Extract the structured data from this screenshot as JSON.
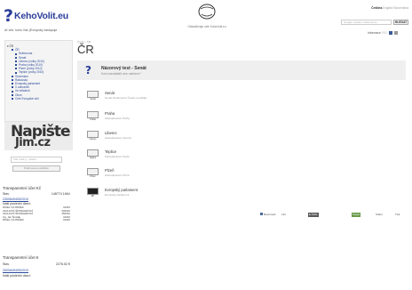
{
  "header": {
    "logo_mark": "?",
    "logo_text": "KehoVolit.eu",
    "tagline": "Ať víte, koho Vás (Evropský zastupuje",
    "center_link": "Oblasti/kraje celé KohoVolit.eu",
    "lang": {
      "prefix": "Čeština",
      "sep1": "English",
      "sep2": "Slovenčina"
    },
    "search_placeholder": "Google: hledat v dokumentu",
    "search_button": "HLEDAT",
    "info_label": "Informace",
    "info_link": "RSS"
  },
  "sidebar": {
    "tree": [
      {
        "level": 0,
        "label": "ČR"
      },
      {
        "level": 1,
        "label": "ČR"
      },
      {
        "level": 2,
        "label": "Sněmovna"
      },
      {
        "level": 2,
        "label": "Senát"
      },
      {
        "level": 2,
        "label": "Liberec (volby 2010)"
      },
      {
        "level": 2,
        "label": "Praha (volby 2010)"
      },
      {
        "level": 2,
        "label": "Plzeň (volby 2010)"
      },
      {
        "level": 2,
        "label": "Teplice (volby 2010)"
      },
      {
        "level": 1,
        "label": "Slovensko"
      },
      {
        "level": 1,
        "label": "Rakousko"
      },
      {
        "level": 1,
        "label": "Evropský parlament"
      },
      {
        "level": 1,
        "label": "V zahraničí"
      },
      {
        "level": 1,
        "label": "Ve městech"
      },
      {
        "level": 1,
        "label": "Obce"
      },
      {
        "level": 1,
        "label": "Celé Evropské uhlí"
      }
    ],
    "napiste_line1": "Napište",
    "napiste_line2": "Jim.cz",
    "email_placeholder": "Váš mail(+), ostatní...",
    "send_button": "Pošli pouze politikům",
    "accounts": [
      {
        "title": "Transparentní účet Kč",
        "state_label": "Stav",
        "state_value": "148774 16Kč",
        "account_no": "2300849405/2010",
        "recent_label": "Naši poslední dárci:",
        "transactions": [
          {
            "name": "PAVEL VOJTÉŠEK",
            "amount": "100Kč"
          },
          {
            "name": "VACHOVÁ ŠPINDLEROVÁ",
            "amount": "5000Kč"
          },
          {
            "name": "VACHOVÁ ŠPINDLEROVÁ",
            "amount": "3500Kč"
          },
          {
            "name": "Ing. Jan Šimčák",
            "amount": "100Kč"
          },
          {
            "name": "PAVEL VOJTÉŠEK",
            "amount": "100Kč"
          }
        ]
      },
      {
        "title": "Transparentní účet €",
        "state_label": "Stav",
        "state_value": "2276.52 €",
        "account_no": "2600849405/2010",
        "recent_label": "Naši poslední dárci:"
      }
    ]
  },
  "main": {
    "breadcrumb": "Úvod > ČR",
    "title": "ČR",
    "featured": {
      "title": "Názorový test - Senát",
      "subtitle": "Koho kandidátů více nabídne?"
    },
    "items": [
      {
        "name": "Senát",
        "sub": "Senát Parlamentu České republiky",
        "icon_label": "Senát"
      },
      {
        "name": "Praha",
        "sub": "Zastupitelstvo Prahy",
        "icon_label": "Praha"
      },
      {
        "name": "Liberec",
        "sub": "Zastupitelstvo Liberce",
        "icon_label": "Liberec"
      },
      {
        "name": "Teplice",
        "sub": "Zastupitelstvo Teplic",
        "icon_label": "Teplice"
      },
      {
        "name": "Plzeň",
        "sub": "Zastupitelstvo Plzně",
        "icon_label": "Plzeň"
      },
      {
        "name": "Evropský parlament",
        "sub": "Evropský parlament",
        "icon_label": "EP"
      }
    ]
  },
  "toolbar": {
    "bookmark": "Bookmark",
    "like": "Líbí",
    "email_btn": "E-MAIL",
    "tweet": "Tweet",
    "share": "Sdílet",
    "print": "Tisk"
  }
}
